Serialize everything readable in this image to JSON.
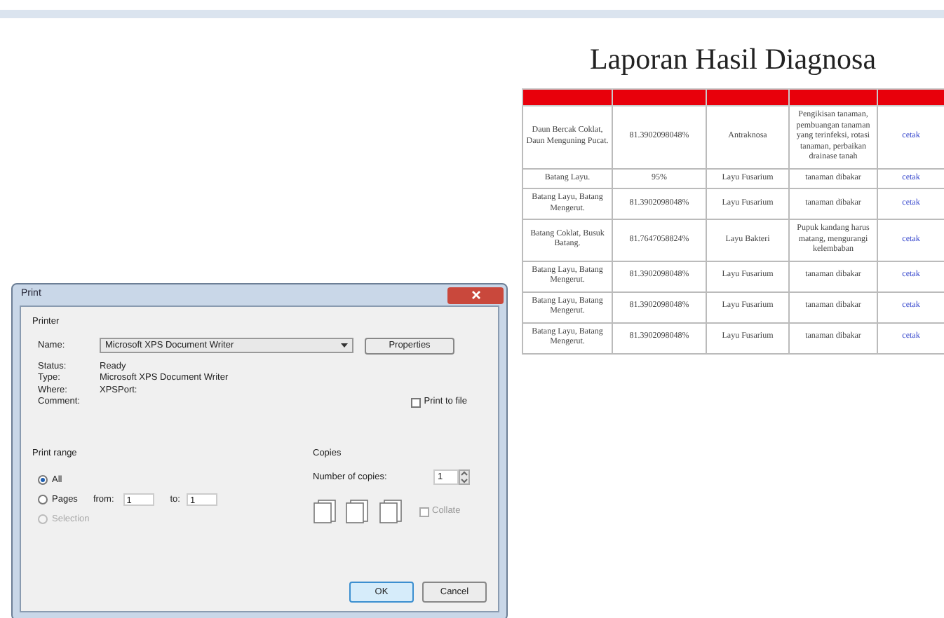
{
  "page": {
    "title": "Laporan Hasil Diagnosa"
  },
  "table": {
    "rows": [
      {
        "cells": [
          "Daun Bercak Coklat, Daun Menguning Pucat.",
          "81.3902098048%",
          "Antraknosa",
          "Pengikisan tanaman, pembuangan tanaman yang terinfeksi, rotasi tanaman, perbaikan drainase tanah"
        ],
        "action": "cetak"
      },
      {
        "cells": [
          "Batang Layu.",
          "95%",
          "Layu Fusarium",
          "tanaman dibakar"
        ],
        "action": "cetak"
      },
      {
        "cells": [
          "Batang Layu, Batang Mengerut.",
          "81.3902098048%",
          "Layu Fusarium",
          "tanaman dibakar"
        ],
        "action": "cetak"
      },
      {
        "cells": [
          "Batang Coklat, Busuk Batang.",
          "81.7647058824%",
          "Layu Bakteri",
          "Pupuk kandang harus matang, mengurangi kelembaban"
        ],
        "action": "cetak"
      },
      {
        "cells": [
          "Batang Layu, Batang Mengerut.",
          "81.3902098048%",
          "Layu Fusarium",
          "tanaman dibakar"
        ],
        "action": "cetak"
      },
      {
        "cells": [
          "Batang Layu, Batang Mengerut.",
          "81.3902098048%",
          "Layu Fusarium",
          "tanaman dibakar"
        ],
        "action": "cetak"
      },
      {
        "cells": [
          "Batang Layu, Batang Mengerut.",
          "81.3902098048%",
          "Layu Fusarium",
          "tanaman dibakar"
        ],
        "action": "cetak"
      }
    ]
  },
  "print_dialog": {
    "title": "Print",
    "printer": {
      "label": "Printer",
      "name_label": "Name:",
      "name_value": "Microsoft XPS Document Writer",
      "properties_button": "Properties",
      "info": [
        {
          "label": "Status:",
          "value": "Ready"
        },
        {
          "label": "Type:",
          "value": "Microsoft XPS Document Writer"
        },
        {
          "label": "Where:",
          "value": "XPSPort:"
        },
        {
          "label": "Comment:"
        }
      ],
      "print_to_file": {
        "label": "Print to file",
        "checked": false
      }
    },
    "print_range": {
      "label": "Print range",
      "options": [
        {
          "kind": "plain",
          "label": "All",
          "selected": true,
          "disabled": false
        },
        {
          "kind": "pages",
          "label": "Pages",
          "selected": false,
          "disabled": false,
          "from_label": "from:",
          "from_value": "1",
          "to_label": "to:",
          "to_value": "1"
        },
        {
          "kind": "plain",
          "label": "Selection",
          "selected": false,
          "disabled": true
        }
      ]
    },
    "copies": {
      "label": "Copies",
      "number_label": "Number of copies:",
      "number_value": "1",
      "collate": {
        "label": "Collate",
        "checked": false
      }
    },
    "buttons": [
      {
        "label": "OK",
        "default": true
      },
      {
        "label": "Cancel",
        "default": false
      }
    ]
  }
}
